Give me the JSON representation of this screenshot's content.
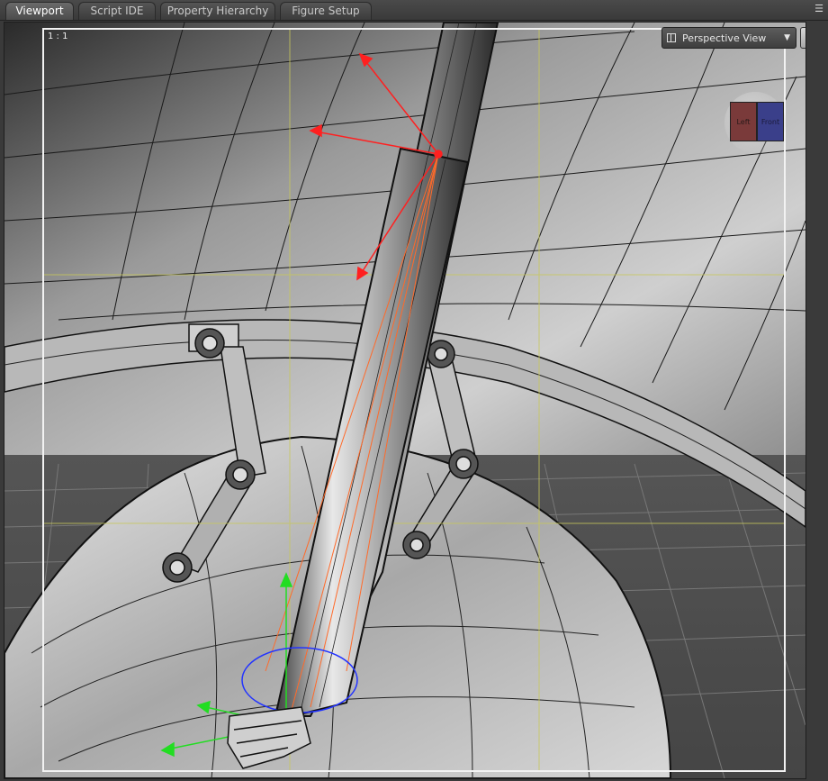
{
  "tabs": [
    {
      "label": "Viewport",
      "active": true
    },
    {
      "label": "Script IDE",
      "active": false
    },
    {
      "label": "Property Hierarchy",
      "active": false
    },
    {
      "label": "Figure Setup",
      "active": false
    }
  ],
  "viewport": {
    "aspect_label": "1 : 1",
    "view_selector": "Perspective View",
    "view_caret": "▼",
    "cube_left": "Left",
    "cube_front": "Front"
  },
  "icons": {
    "tab_menu": "panel-menu-icon",
    "view_options": "view-options-icon",
    "orbit": "orbit-icon",
    "pan": "pan-icon",
    "zoom": "zoom-icon",
    "frame": "frame-icon",
    "home": "home-view-icon"
  },
  "colors": {
    "background": "#5a5a5a",
    "frame": "#f2f2f2",
    "guides": "#c8c85a",
    "gizmo_red": "#ff2020",
    "gizmo_green": "#22dd22",
    "gizmo_blue": "#2233ff",
    "bone": "#ff6a2a"
  }
}
